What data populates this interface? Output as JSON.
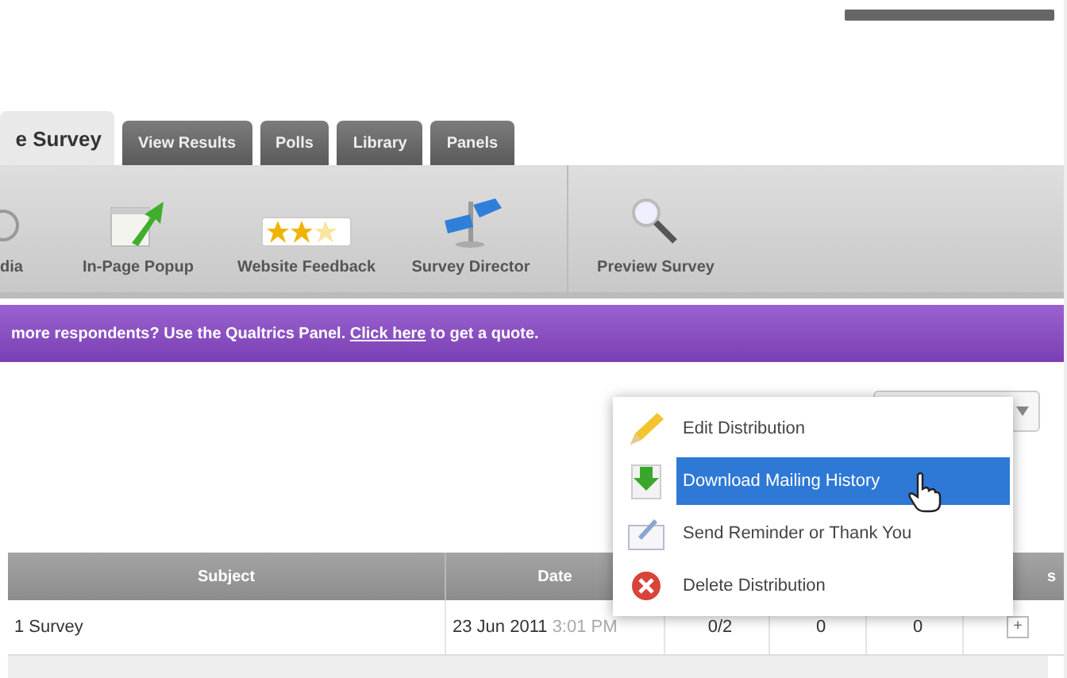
{
  "tabs": [
    {
      "label": "e Survey",
      "selected": true
    },
    {
      "label": "View Results",
      "selected": false
    },
    {
      "label": "Polls",
      "selected": false
    },
    {
      "label": "Library",
      "selected": false
    },
    {
      "label": "Panels",
      "selected": false
    }
  ],
  "toolbar": [
    {
      "label": "dia",
      "kind": "media"
    },
    {
      "label": "In-Page Popup",
      "kind": "popup"
    },
    {
      "label": "Website Feedback",
      "kind": "feedback"
    },
    {
      "label": "Survey Director",
      "kind": "director"
    },
    {
      "label": "Preview Survey",
      "kind": "preview"
    }
  ],
  "banner": {
    "text_before": "more respondents? Use the Qualtrics Panel. ",
    "link": "Click here",
    "text_after": " to get a quote."
  },
  "menu": [
    {
      "label": "Edit Distribution",
      "kind": "edit",
      "selected": false
    },
    {
      "label": "Download Mailing History",
      "kind": "download",
      "selected": true
    },
    {
      "label": "Send Reminder or Thank You",
      "kind": "remind",
      "selected": false
    },
    {
      "label": "Delete Distribution",
      "kind": "delete",
      "selected": false
    }
  ],
  "table": {
    "columns": [
      "Subject",
      "Date"
    ],
    "column_6": "s",
    "rows": [
      {
        "subject": "1 Survey",
        "date": "23 Jun 2011",
        "time": "3:01 PM",
        "column_3": "0/2",
        "column_4": "0",
        "column_5": "0",
        "action": "+"
      }
    ]
  }
}
